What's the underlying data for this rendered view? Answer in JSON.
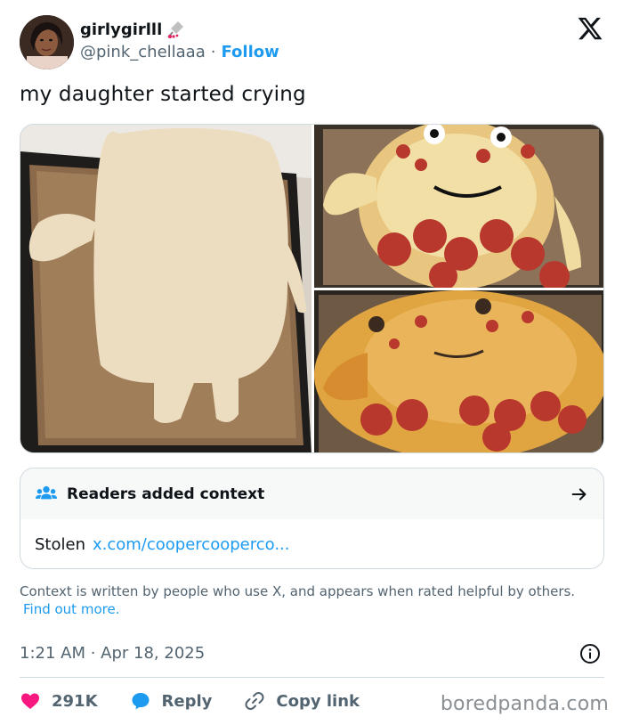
{
  "author": {
    "display_name": "girlygirlll",
    "handle": "@pink_chellaaa",
    "separator": "·",
    "follow_label": "Follow"
  },
  "tweet": {
    "text": "my daughter started crying"
  },
  "media": {
    "photos": [
      {
        "icon": "raw-dough-figure-photo"
      },
      {
        "icon": "uncooked-pizza-figure-photo"
      },
      {
        "icon": "baked-pizza-figure-photo"
      }
    ]
  },
  "context_note": {
    "title": "Readers added context",
    "body_text": "Stolen",
    "link_text": "x.com/coopercooperco..."
  },
  "disclaimer": {
    "text": "Context is written by people who use X, and appears when rated helpful by others.",
    "link_text": "Find out more."
  },
  "meta": {
    "timestamp": "1:21 AM · Apr 18, 2025"
  },
  "actions": {
    "like_count": "291K",
    "reply_label": "Reply",
    "copy_label": "Copy link"
  },
  "watermark": "boredpanda.com",
  "colors": {
    "accent": "#1d9bf0",
    "like": "#f91880",
    "text": "#0f1419",
    "muted": "#536471"
  }
}
